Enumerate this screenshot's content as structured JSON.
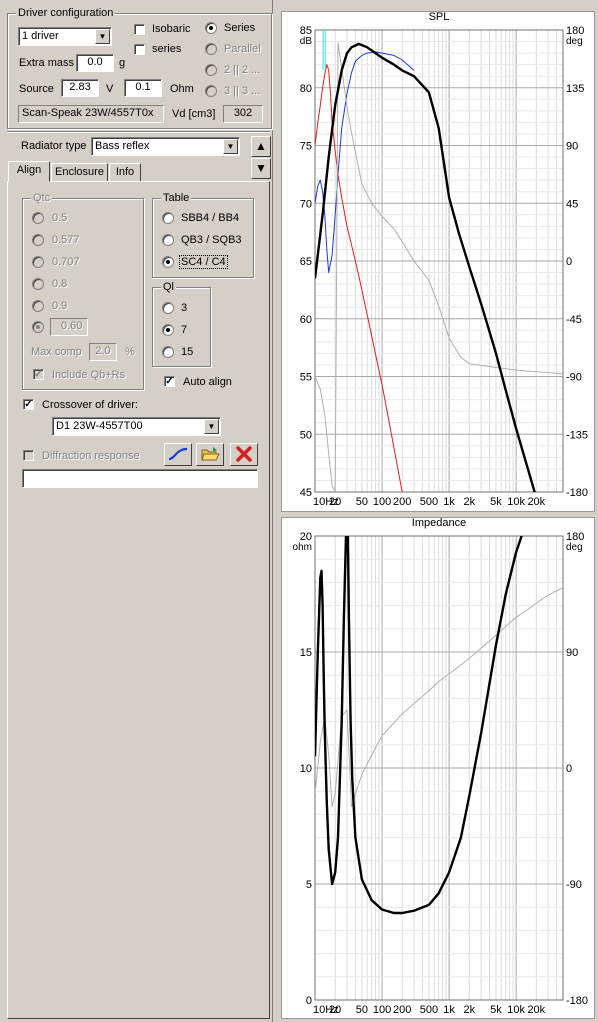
{
  "driver_config": {
    "title": "Driver configuration",
    "driver_count": "1 driver",
    "isobaric_label": "Isobaric",
    "series_label": "series",
    "extra_mass_label": "Extra mass",
    "extra_mass_value": "0.0",
    "extra_mass_unit": "g",
    "source_label": "Source",
    "source_voltage": "2.83",
    "source_voltage_unit": "V",
    "source_ohm": "0.1",
    "source_ohm_unit": "Ohm",
    "driver_name": "Scan-Speak 23W/4557T0x",
    "vd_label": "Vd [cm3]",
    "vd_value": "302",
    "wiring": [
      {
        "label": "Series",
        "selected": true,
        "enabled": true
      },
      {
        "label": "Parallel",
        "selected": false,
        "enabled": false
      },
      {
        "label": "2 || 2 ...",
        "selected": false,
        "enabled": false
      },
      {
        "label": "3 || 3 ...",
        "selected": false,
        "enabled": false
      }
    ]
  },
  "radiator": {
    "label": "Radiator type",
    "value": "Bass reflex",
    "up_arrow": "▲",
    "down_arrow": "▼"
  },
  "tabs": [
    {
      "label": "Align",
      "active": true
    },
    {
      "label": "Enclosure",
      "active": false
    },
    {
      "label": "Info",
      "active": false
    }
  ],
  "qtc": {
    "title": "Qtc",
    "options": [
      "0.5",
      "0.577",
      "0.707",
      "0.8",
      "0.9"
    ],
    "custom_value": "0.60",
    "max_comp_label": "Max comp",
    "max_comp_value": "2.0",
    "max_comp_unit": "%",
    "include_label": "Include Qb+Rs"
  },
  "table": {
    "title": "Table",
    "options": [
      {
        "label": "SBB4 / BB4",
        "selected": false
      },
      {
        "label": "QB3 / SQB3",
        "selected": false
      },
      {
        "label": "SC4 / C4",
        "selected": true
      }
    ]
  },
  "ql": {
    "title": "Ql",
    "options": [
      {
        "label": "3",
        "selected": false
      },
      {
        "label": "7",
        "selected": true
      },
      {
        "label": "15",
        "selected": false
      }
    ]
  },
  "auto_align": {
    "label": "Auto align",
    "checked": true
  },
  "crossover": {
    "label": "Crossover of driver:",
    "checked": true,
    "value": "D1 23W-4557T00"
  },
  "diffraction": {
    "label": "Diffraction response",
    "checked": false,
    "text_value": ""
  },
  "icons": [
    "curve-icon",
    "open-folder-icon",
    "delete-icon"
  ],
  "colors": {
    "accent_red": "#d42020",
    "curve_blue": "#1a3bd8",
    "curve_red": "#e02020",
    "phase_gray": "#b0b0b0",
    "marker_cyan": "#3fd8d8"
  },
  "chart_data": [
    {
      "type": "line",
      "title": "SPL",
      "xlabel": "",
      "ylabel": "dB",
      "y2label": "deg",
      "x_scale": "log",
      "xlim": [
        10,
        50000
      ],
      "ylim": [
        45,
        85
      ],
      "y2lim": [
        -180,
        180
      ],
      "grid": true,
      "x_tick_labels": [
        "10Hz",
        "20",
        "50",
        "100",
        "200",
        "500",
        "1k",
        "2k",
        "5k",
        "10k",
        "20k"
      ],
      "x_tick_values": [
        10,
        20,
        50,
        100,
        200,
        500,
        1000,
        2000,
        5000,
        10000,
        20000
      ],
      "y_ticks": [
        85,
        80,
        75,
        70,
        65,
        60,
        55,
        50,
        45
      ],
      "y2_ticks": [
        180,
        135,
        90,
        45,
        0,
        -45,
        -90,
        -135,
        -180
      ],
      "series": [
        {
          "axis": "left",
          "color": "#000000",
          "x": [
            10,
            13,
            16,
            20,
            25,
            30,
            35,
            45,
            60,
            80,
            100,
            150,
            200,
            300,
            500,
            700,
            1000,
            1400,
            2000,
            3000,
            5000,
            7000,
            10000,
            15000,
            20000,
            30000,
            50000
          ],
          "y": [
            63.5,
            69,
            74,
            78.5,
            81.5,
            83,
            83.5,
            83.8,
            83.5,
            83,
            82.6,
            82,
            81.5,
            81,
            79.6,
            76.5,
            70.5,
            67.4,
            64.5,
            61.3,
            57,
            53.8,
            50.5,
            47,
            44.5,
            41.5,
            37.5
          ]
        },
        {
          "axis": "left",
          "color": "#1a3bd8",
          "x": [
            10,
            11,
            12,
            13,
            14,
            15,
            16,
            18,
            20,
            22,
            25,
            30,
            35,
            40,
            50,
            60,
            80,
            100,
            150,
            200,
            250,
            300
          ],
          "y": [
            70,
            71.5,
            72,
            71,
            69,
            66,
            64,
            65.5,
            69,
            72.5,
            76.5,
            79.5,
            81.3,
            82.3,
            82.8,
            83,
            83.1,
            83,
            82.8,
            82.4,
            81.9,
            81.5
          ]
        },
        {
          "axis": "left",
          "color": "#e02020",
          "x": [
            10,
            11,
            12,
            13,
            14,
            15,
            16,
            17,
            18,
            20,
            22,
            25,
            30,
            40,
            50,
            70,
            100,
            130,
            160,
            200
          ],
          "y": [
            75,
            77,
            78.5,
            80,
            81.2,
            82,
            81.5,
            79.5,
            77,
            74.5,
            72.5,
            70.5,
            68,
            65,
            62.5,
            58.5,
            54.3,
            50.8,
            48,
            45
          ]
        },
        {
          "axis": "right",
          "color": "#b0b0b0",
          "x": [
            10,
            12,
            14,
            16,
            18,
            20,
            22,
            25,
            30,
            35,
            40,
            50,
            70,
            100,
            150,
            200,
            300,
            500,
            700,
            1000,
            1500,
            2000,
            5000,
            10000,
            30000,
            50000
          ],
          "y": [
            -90,
            -100,
            -120,
            -150,
            -175,
            -180,
            170,
            150,
            120,
            100,
            85,
            60,
            45,
            35,
            25,
            15,
            0,
            -15,
            -35,
            -60,
            -75,
            -80,
            -83,
            -85,
            -87,
            -88
          ]
        }
      ]
    },
    {
      "type": "line",
      "title": "Impedance",
      "xlabel": "",
      "ylabel": "ohm",
      "y2label": "deg",
      "x_scale": "log",
      "xlim": [
        10,
        50000
      ],
      "ylim": [
        0,
        20
      ],
      "y2lim": [
        -180,
        180
      ],
      "grid": true,
      "x_tick_labels": [
        "10Hz",
        "20",
        "50",
        "100",
        "200",
        "500",
        "1k",
        "2k",
        "5k",
        "10k",
        "20k"
      ],
      "x_tick_values": [
        10,
        20,
        50,
        100,
        200,
        500,
        1000,
        2000,
        5000,
        10000,
        20000
      ],
      "y_ticks": [
        20,
        15,
        10,
        5,
        0
      ],
      "y2_ticks": [
        180,
        90,
        0,
        -90,
        -180
      ],
      "series": [
        {
          "axis": "left",
          "color": "#000000",
          "x": [
            10,
            11,
            12,
            12.5,
            13,
            13.5,
            14,
            15,
            16,
            18,
            20,
            22,
            25,
            27,
            29,
            30,
            31,
            32,
            34,
            36,
            40,
            50,
            70,
            100,
            150,
            200,
            300,
            500,
            700,
            1000,
            1500,
            2000,
            3000,
            5000,
            7000,
            10000,
            15000,
            17000
          ],
          "y": [
            10.5,
            15,
            18.2,
            18.5,
            17,
            14,
            11.5,
            8.5,
            6.5,
            5,
            5.5,
            7,
            12,
            16.5,
            20,
            22,
            20,
            16.5,
            12,
            9.5,
            7,
            5.2,
            4.3,
            3.9,
            3.75,
            3.75,
            3.85,
            4.1,
            4.6,
            5.5,
            7,
            8.8,
            11.5,
            15.3,
            17.5,
            19.3,
            20.8,
            21.5
          ]
        },
        {
          "axis": "right",
          "color": "#b0b0b0",
          "x": [
            10,
            12,
            14,
            16,
            18,
            20,
            25,
            30,
            35,
            40,
            50,
            70,
            100,
            150,
            200,
            300,
            500,
            700,
            1000,
            1500,
            2000,
            3000,
            5000,
            7000,
            10000,
            15000,
            20000,
            30000,
            50000
          ],
          "y": [
            -20,
            20,
            40,
            10,
            -30,
            -20,
            40,
            45,
            -30,
            -20,
            -5,
            10,
            25,
            35,
            42,
            50,
            60,
            67,
            73,
            80,
            85,
            93,
            103,
            110,
            117,
            123,
            128,
            134,
            140
          ]
        }
      ]
    }
  ]
}
